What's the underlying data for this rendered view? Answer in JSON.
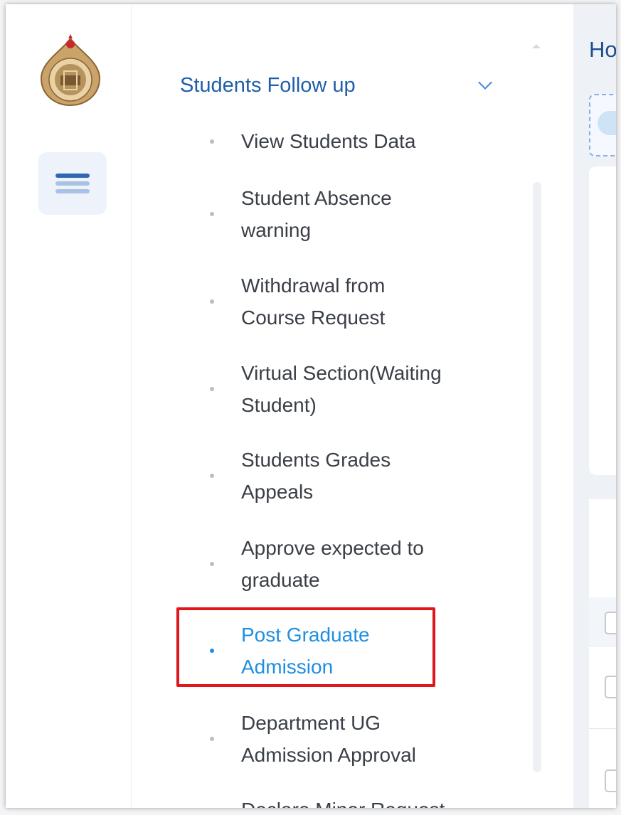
{
  "main": {
    "page_title": "Ho"
  },
  "sidebar": {
    "section": {
      "title": "Students Follow up",
      "expanded": true,
      "chevron_icon": "chevron-down-icon"
    },
    "items": [
      {
        "label": "View Students Data"
      },
      {
        "label": "Student Absence warning"
      },
      {
        "label": "Withdrawal from Course Request"
      },
      {
        "label": "Virtual Section(Waiting Student)"
      },
      {
        "label": "Students Grades Appeals"
      },
      {
        "label": "Approve expected to graduate"
      },
      {
        "label": "Post Graduate Admission"
      },
      {
        "label": "Department UG Admission Approval"
      },
      {
        "label": "Declare Minor Request"
      }
    ],
    "active_item": "Post Graduate Admission"
  },
  "icons": {
    "logo": "university-seal-logo",
    "menu": "hamburger-menu-icon"
  },
  "colors": {
    "section_title": "#1f5fa8",
    "active_item": "#1e8fe0",
    "item_text": "#3a3f47",
    "highlight_border": "#e0161d"
  }
}
